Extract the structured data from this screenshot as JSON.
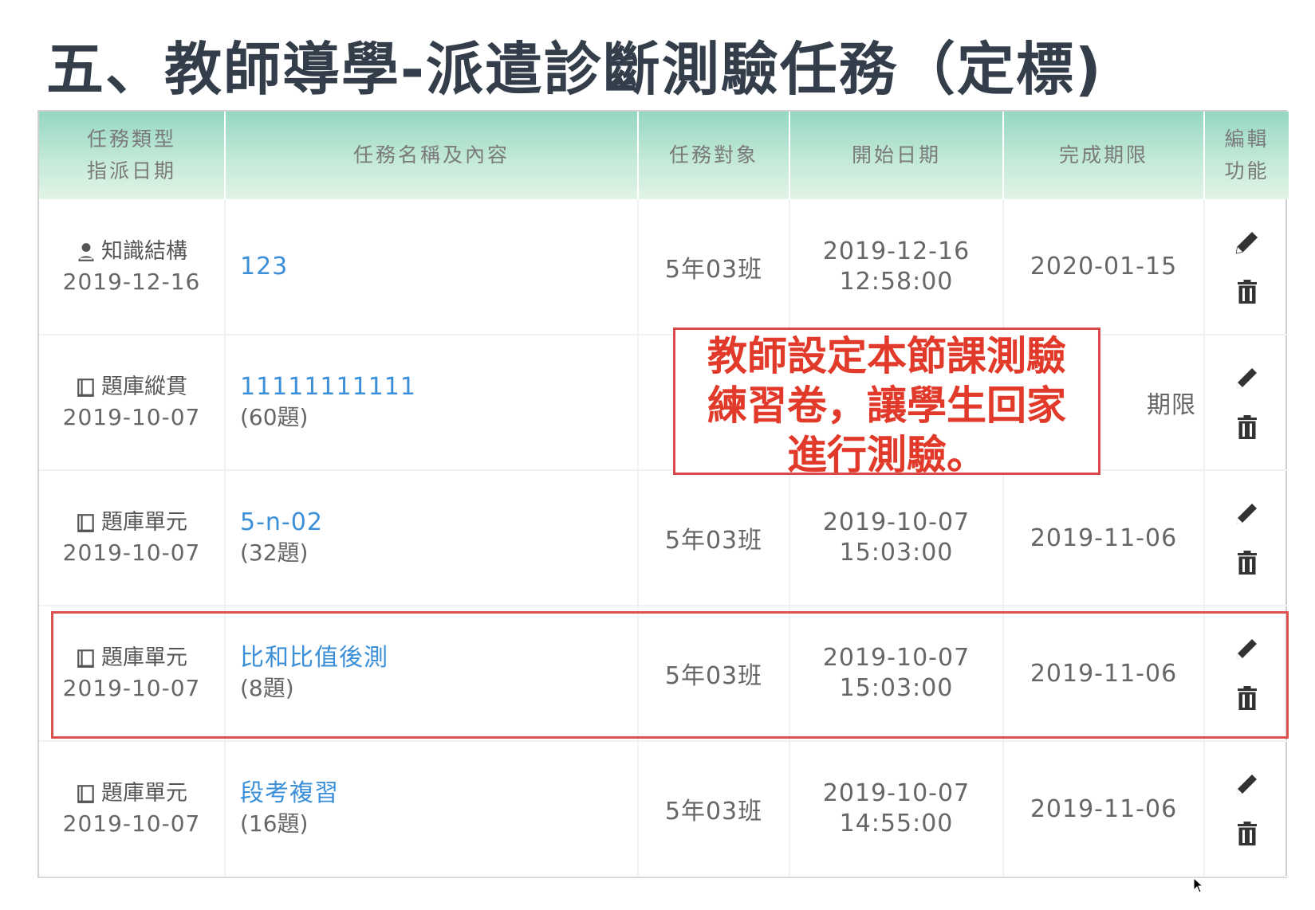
{
  "title": "五、教師導學-派遣診斷測驗任務（定標)",
  "table": {
    "headers": {
      "type_line1": "任務類型",
      "type_line2": "指派日期",
      "name": "任務名稱及內容",
      "target": "任務對象",
      "start": "開始日期",
      "deadline": "完成期限",
      "edit_line1": "編輯",
      "edit_line2": "功能"
    },
    "rows": [
      {
        "type_icon": "person-icon",
        "type": "知識結構",
        "assigned_date": "2019-12-16",
        "name": "123",
        "count": "",
        "target": "5年03班",
        "start_date": "2019-12-16",
        "start_time": "12:58:00",
        "deadline": "2020-01-15"
      },
      {
        "type_icon": "book-icon",
        "type": "題庫縱貫",
        "assigned_date": "2019-10-07",
        "name": "11111111111",
        "count": "(60題)",
        "target": "",
        "start_date": "",
        "start_time": "",
        "deadline": "期限"
      },
      {
        "type_icon": "book-icon",
        "type": "題庫單元",
        "assigned_date": "2019-10-07",
        "name": "5-n-02",
        "count": "(32題)",
        "target": "5年03班",
        "start_date": "2019-10-07",
        "start_time": "15:03:00",
        "deadline": "2019-11-06"
      },
      {
        "type_icon": "book-icon",
        "type": "題庫單元",
        "assigned_date": "2019-10-07",
        "name": "比和比值後測",
        "count": "(8題)",
        "target": "5年03班",
        "start_date": "2019-10-07",
        "start_time": "15:03:00",
        "deadline": "2019-11-06"
      },
      {
        "type_icon": "book-icon",
        "type": "題庫單元",
        "assigned_date": "2019-10-07",
        "name": "段考複習",
        "count": "(16題)",
        "target": "5年03班",
        "start_date": "2019-10-07",
        "start_time": "14:55:00",
        "deadline": "2019-11-06"
      }
    ]
  },
  "callout": {
    "line1": "教師設定本節課測驗",
    "line2": "練習卷，讓學生回家",
    "line3": "進行測驗。"
  },
  "colors": {
    "header_gradient_top": "#94d7c3",
    "link_blue": "#3a8fd8",
    "callout_red": "#e23a2a",
    "highlight_red": "#d9534f"
  },
  "icons": [
    "person-icon",
    "book-icon",
    "pencil-icon",
    "trash-icon",
    "cursor-icon"
  ]
}
